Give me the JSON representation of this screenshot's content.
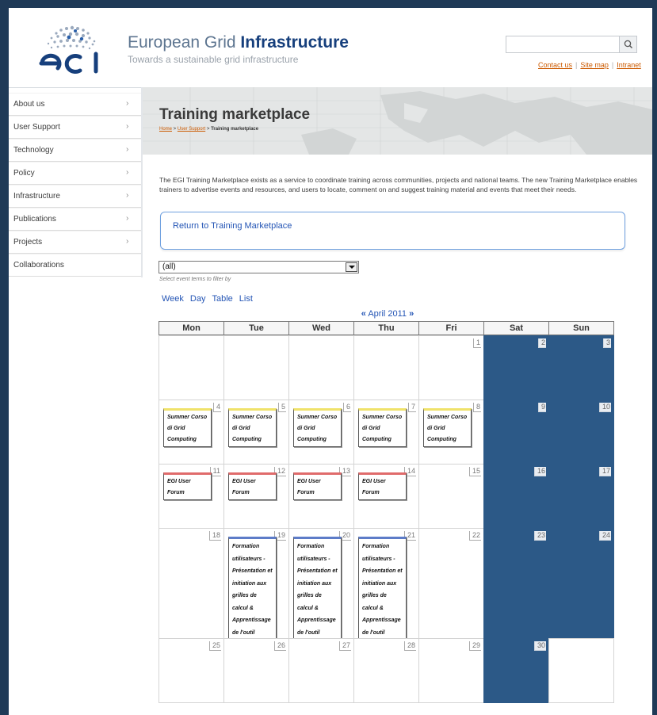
{
  "site": {
    "title_light": "European Grid ",
    "title_bold": "Infrastructure",
    "subtitle": "Towards a sustainable grid infrastructure",
    "logo_text": "egi"
  },
  "toplinks": {
    "contact": "Contact us",
    "sitemap": "Site map",
    "intranet": "Intranet",
    "separator": "|"
  },
  "search": {
    "placeholder": "",
    "button_icon": "search-icon"
  },
  "sidebar": {
    "items": [
      {
        "label": "About us",
        "arrow": "›"
      },
      {
        "label": "User Support",
        "arrow": "›"
      },
      {
        "label": "Technology",
        "arrow": "›"
      },
      {
        "label": "Policy",
        "arrow": "›"
      },
      {
        "label": "Infrastructure",
        "arrow": "›"
      },
      {
        "label": "Publications",
        "arrow": "›"
      },
      {
        "label": "Projects",
        "arrow": "›"
      },
      {
        "label": "Collaborations",
        "arrow": ""
      }
    ]
  },
  "banner": {
    "title": "Training marketplace",
    "crumb_home": "Home",
    "crumb_sep1": " > ",
    "crumb_support": "User Support",
    "crumb_sep2": " > ",
    "crumb_current": "Training marketplace"
  },
  "intro": "The EGI Training Marketplace exists as a service to coordinate training across communities, projects and national teams. The new Training Marketplace enables trainers to advertise events and resources, and users to locate, comment on and suggest training material and events that meet their needs.",
  "return_link": "Return to Training Marketplace",
  "filter": {
    "value": "(all)",
    "help": "Select event terms to filter by"
  },
  "views": [
    "Week",
    "Day",
    "Table",
    "List"
  ],
  "month": {
    "prev": "«",
    "label": "April 2011",
    "next": "»"
  },
  "weekdays": [
    "Mon",
    "Tue",
    "Wed",
    "Thu",
    "Fri",
    "Sat",
    "Sun"
  ],
  "weeks": [
    [
      {
        "day": ""
      },
      {
        "day": ""
      },
      {
        "day": ""
      },
      {
        "day": ""
      },
      {
        "day": "1"
      },
      {
        "day": "2",
        "we": true
      },
      {
        "day": "3",
        "we": true
      }
    ],
    [
      {
        "day": "4",
        "ev": "Summer Corso di Grid Computing",
        "c": "y"
      },
      {
        "day": "5",
        "ev": "Summer Corso di Grid Computing",
        "c": "y"
      },
      {
        "day": "6",
        "ev": "Summer Corso di Grid Computing",
        "c": "y"
      },
      {
        "day": "7",
        "ev": "Summer Corso di Grid Computing",
        "c": "y"
      },
      {
        "day": "8",
        "ev": "Summer Corso di Grid Computing",
        "c": "y"
      },
      {
        "day": "9",
        "we": true
      },
      {
        "day": "10",
        "we": true
      }
    ],
    [
      {
        "day": "11",
        "ev": "EGI User Forum",
        "c": "r"
      },
      {
        "day": "12",
        "ev": "EGI User Forum",
        "c": "r"
      },
      {
        "day": "13",
        "ev": "EGI User Forum",
        "c": "r"
      },
      {
        "day": "14",
        "ev": "EGI User Forum",
        "c": "r"
      },
      {
        "day": "15"
      },
      {
        "day": "16",
        "we": true
      },
      {
        "day": "17",
        "we": true
      }
    ],
    [
      {
        "day": "18"
      },
      {
        "day": "19",
        "ev": "Formation utilisateurs - Présentation et initiation aux grilles de calcul & Apprentissage de l'outil DIRAC",
        "c": "b"
      },
      {
        "day": "20",
        "ev": "Formation utilisateurs - Présentation et initiation aux grilles de calcul & Apprentissage de l'outil DIRAC",
        "c": "b"
      },
      {
        "day": "21",
        "ev": "Formation utilisateurs - Présentation et initiation aux grilles de calcul & Apprentissage de l'outil DIRAC",
        "c": "b"
      },
      {
        "day": "22"
      },
      {
        "day": "23",
        "we": true
      },
      {
        "day": "24",
        "we": true
      }
    ],
    [
      {
        "day": "25"
      },
      {
        "day": "26"
      },
      {
        "day": "27"
      },
      {
        "day": "28"
      },
      {
        "day": "29"
      },
      {
        "day": "30",
        "we": true
      },
      {
        "day": "",
        "empty": true
      }
    ]
  ]
}
